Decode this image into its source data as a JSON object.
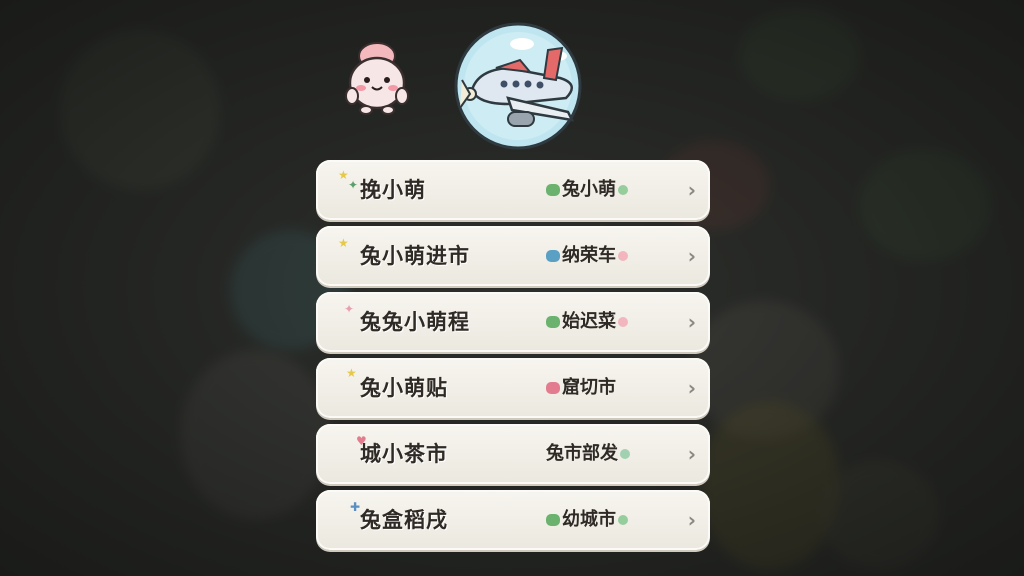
{
  "menu": {
    "rows": [
      {
        "left": "挽小萌",
        "right": "兔小萌"
      },
      {
        "left": "兔小萌进市",
        "right": "纳荣车"
      },
      {
        "left": "兔兔小萌程",
        "right": "始迟菜"
      },
      {
        "left": "兔小萌贴",
        "right": "窟切市"
      },
      {
        "left": "城小茶市",
        "right": "兔市部发"
      },
      {
        "left": "兔盒稻戌",
        "right": "幼城市"
      }
    ],
    "chevron": "›"
  },
  "icons": {
    "mascot": "bunny-mascot-icon",
    "globe": "airplane-globe-icon",
    "row_arrow": "chevron-right-icon"
  },
  "colors": {
    "background": "#2b2d2a",
    "row_fill": "#f2efe7",
    "text": "#2f2a26",
    "chevron": "#8c8780",
    "globe": "#bfe6f0",
    "plane_body": "#dfe8f0",
    "plane_accent": "#e46a6a"
  }
}
